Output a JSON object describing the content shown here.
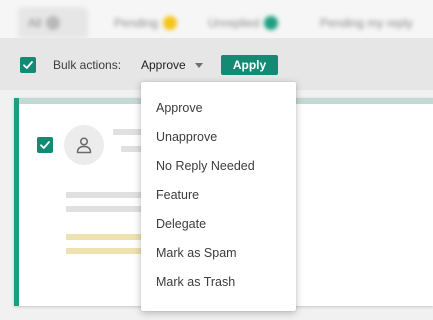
{
  "tabs": [
    {
      "label": "All",
      "badge_color": "#b9b9b9"
    },
    {
      "label": "Pending",
      "badge_color": "#f5c518"
    },
    {
      "label": "Unreplied",
      "badge_color": "#1e9e80"
    },
    {
      "label": "Pending my reply",
      "badge_color": ""
    }
  ],
  "bulk": {
    "label": "Bulk actions:",
    "selected": "Approve",
    "apply_label": "Apply",
    "all_checked": true
  },
  "menu": {
    "items": [
      "Approve",
      "Unapprove",
      "No Reply Needed",
      "Feature",
      "Delegate",
      "Mark as Spam",
      "Mark as Trash"
    ]
  },
  "colors": {
    "accent": "#138a74",
    "card_border": "#1e9e80"
  },
  "icons": {
    "avatar": "user-icon",
    "check": "check-icon",
    "select": "caret-down-icon"
  }
}
